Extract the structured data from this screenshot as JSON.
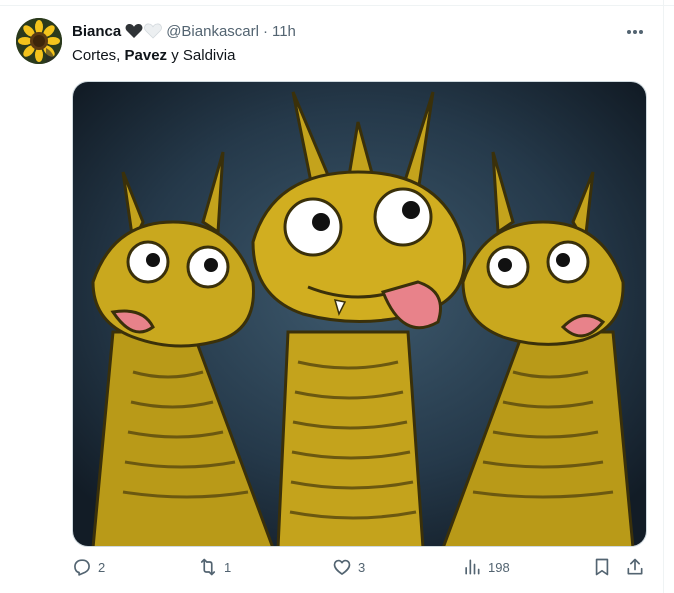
{
  "tweet": {
    "author_name": "Bianca",
    "handle": "@Biankascarl",
    "separator": "·",
    "time": "11h",
    "text_parts": [
      "Cortes, ",
      "Pavez",
      " y Saldivia"
    ],
    "image_alt": "Three-headed golden cartoon dragon meme"
  },
  "actions": {
    "reply_count": "2",
    "retweet_count": "1",
    "like_count": "3",
    "views_count": "198"
  },
  "icons": {
    "verified_like": [
      "black-heart-icon",
      "white-heart-icon"
    ],
    "more": "more-icon",
    "reply": "reply-icon",
    "retweet": "retweet-icon",
    "like": "heart-icon",
    "views": "views-icon",
    "bookmark": "bookmark-icon",
    "share": "share-icon"
  },
  "colors": {
    "text": "#0f1419",
    "muted": "#536471",
    "dragon": "#c9a81e",
    "dragon_dark": "#8a7212",
    "background": "#1e3040",
    "tongue": "#e8828a"
  }
}
